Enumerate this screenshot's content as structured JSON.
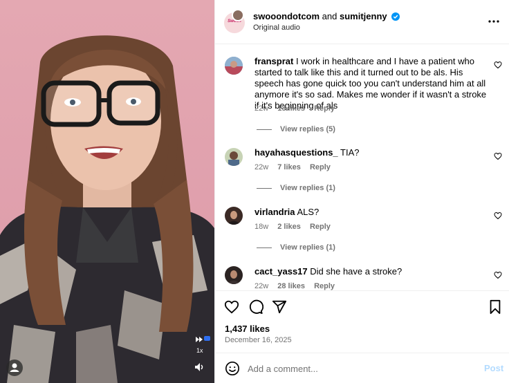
{
  "post": {
    "author": "swooondotcom",
    "connector": "and",
    "collaborator": "sumitjenny",
    "audio": "Original audio",
    "avatar_text": "Swoon",
    "likes": "1,437 likes",
    "date": "December 16, 2025"
  },
  "video": {
    "speed_label": "1x"
  },
  "comments": [
    {
      "user": "fransprat",
      "text": "I work in healthcare and I have a patient who started to talk like this and it turned out to be als. His speech has gone quick too you can't understand him at all anymore it's so sad. Makes me wonder if it wasn't a stroke if it's beginning of als",
      "age": "22w",
      "likes": "13 likes",
      "reply": "Reply",
      "view_replies": "View replies (5)"
    },
    {
      "user": "hayahasquestions_",
      "text": "TIA?",
      "age": "22w",
      "likes": "7 likes",
      "reply": "Reply",
      "view_replies": "View replies (1)"
    },
    {
      "user": "virlandria",
      "text": "ALS?",
      "age": "18w",
      "likes": "2 likes",
      "reply": "Reply",
      "view_replies": "View replies (1)"
    },
    {
      "user": "cact_yass17",
      "text": "Did she have a stroke?",
      "age": "22w",
      "likes": "28 likes",
      "reply": "Reply"
    }
  ],
  "composer": {
    "placeholder": "Add a comment...",
    "post_label": "Post"
  },
  "icons": {
    "verified": "verified-badge-icon",
    "more": "more-options-icon",
    "like": "heart-icon",
    "comment": "comment-icon",
    "share": "share-icon",
    "save": "bookmark-icon",
    "emoji": "emoji-icon",
    "mute": "speaker-icon",
    "tag": "user-tag-icon",
    "speed": "playback-speed-icon"
  },
  "colors": {
    "verified": "#0095f6",
    "post_disabled": "#b3dbff",
    "muted_text": "#737373",
    "video_background": "#df9fac"
  }
}
